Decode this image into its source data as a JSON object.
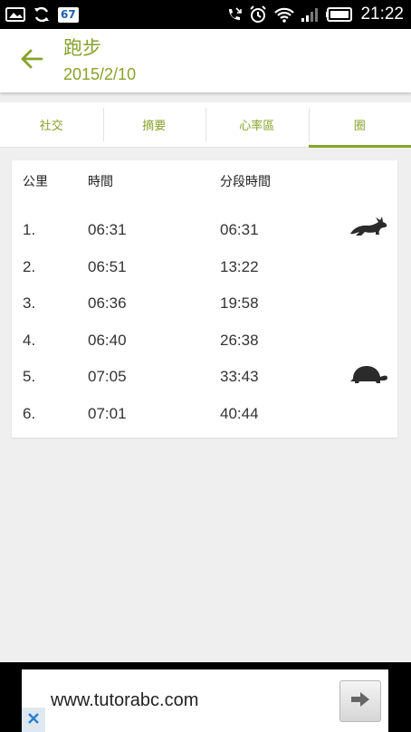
{
  "status_bar": {
    "notification_badge": "67",
    "time": "21:22",
    "icons": [
      "image-icon",
      "sync-icon",
      "badge-67",
      "missed-call-icon",
      "alarm-icon",
      "wifi-icon",
      "signal-icon",
      "battery-icon"
    ]
  },
  "header": {
    "title": "跑步",
    "subtitle": "2015/2/10",
    "accent_color": "#86a32a"
  },
  "tabs": [
    {
      "label": "社交",
      "active": false
    },
    {
      "label": "摘要",
      "active": false
    },
    {
      "label": "心率區",
      "active": false
    },
    {
      "label": "圈",
      "active": true
    }
  ],
  "laps_table": {
    "columns": [
      "公里",
      "時間",
      "分段時間"
    ],
    "rows": [
      {
        "km": "1.",
        "time": "06:31",
        "split": "06:31",
        "icon": "rabbit-icon"
      },
      {
        "km": "2.",
        "time": "06:51",
        "split": "13:22",
        "icon": ""
      },
      {
        "km": "3.",
        "time": "06:36",
        "split": "19:58",
        "icon": ""
      },
      {
        "km": "4.",
        "time": "06:40",
        "split": "26:38",
        "icon": ""
      },
      {
        "km": "5.",
        "time": "07:05",
        "split": "33:43",
        "icon": "turtle-icon"
      },
      {
        "km": "6.",
        "time": "07:01",
        "split": "40:44",
        "icon": ""
      }
    ]
  },
  "ad": {
    "url": "www.tutorabc.com"
  }
}
